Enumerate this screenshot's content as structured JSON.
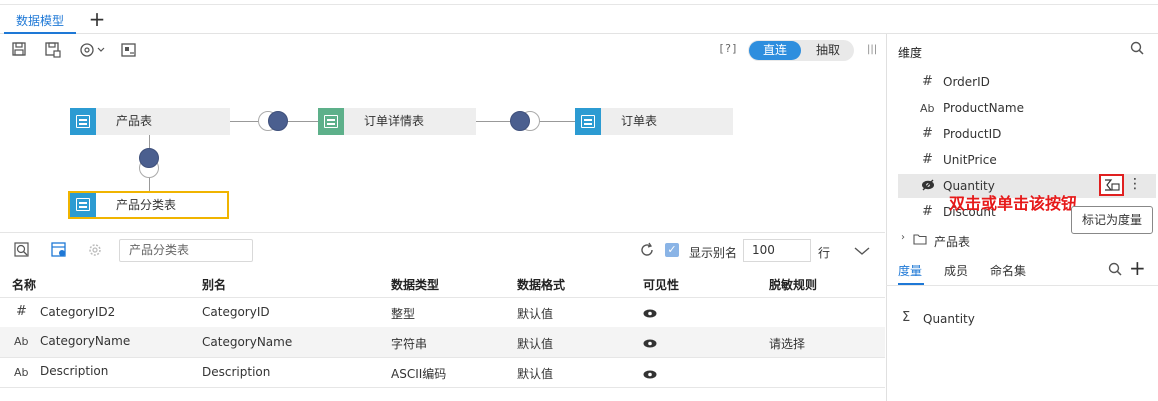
{
  "tabs": {
    "active_label": "数据模型",
    "add_label": "+"
  },
  "toolbar": {
    "help_label": "[?]",
    "mode_on": "直连",
    "mode_off": "抽取",
    "panel_glyph": "|||"
  },
  "canvas": {
    "nodes": {
      "product": "产品表",
      "order_detail": "订单详情表",
      "order": "订单表",
      "product_category": "产品分类表"
    }
  },
  "bottom": {
    "search_value": "产品分类表",
    "show_alias_label": "显示别名",
    "rows_value": "100",
    "rows_unit": "行",
    "columns": [
      "名称",
      "别名",
      "数据类型",
      "数据格式",
      "可见性",
      "脱敏规则"
    ],
    "rows": [
      {
        "icon": "#",
        "name": "CategoryID2",
        "alias": "CategoryID",
        "type": "整型",
        "format": "默认值",
        "rule": ""
      },
      {
        "icon": "Ab",
        "name": "CategoryName",
        "alias": "CategoryName",
        "type": "字符串",
        "format": "默认值",
        "rule": "请选择"
      },
      {
        "icon": "Ab",
        "name": "Description",
        "alias": "Description",
        "type": "ASCII编码",
        "format": "默认值",
        "rule": ""
      }
    ]
  },
  "right": {
    "dimension_title": "维度",
    "fields": [
      {
        "icon": "#",
        "name": "OrderID"
      },
      {
        "icon": "Ab",
        "name": "ProductName"
      },
      {
        "icon": "#",
        "name": "ProductID"
      },
      {
        "icon": "#",
        "name": "UnitPrice"
      },
      {
        "icon": "eye",
        "name": "Quantity"
      },
      {
        "icon": "#",
        "name": "Discount"
      }
    ],
    "folder_label": "产品表",
    "annotation": "双击或单击该按钮",
    "tooltip": "标记为度量",
    "measure_tabs": [
      "度量",
      "成员",
      "命名集"
    ],
    "measure_item": "Quantity",
    "sigma": "Σ"
  },
  "colors": {
    "accent": "#1e78d6",
    "annotation": "#e61919",
    "node_blue": "#2c9bd2",
    "node_green": "#5db08a"
  }
}
